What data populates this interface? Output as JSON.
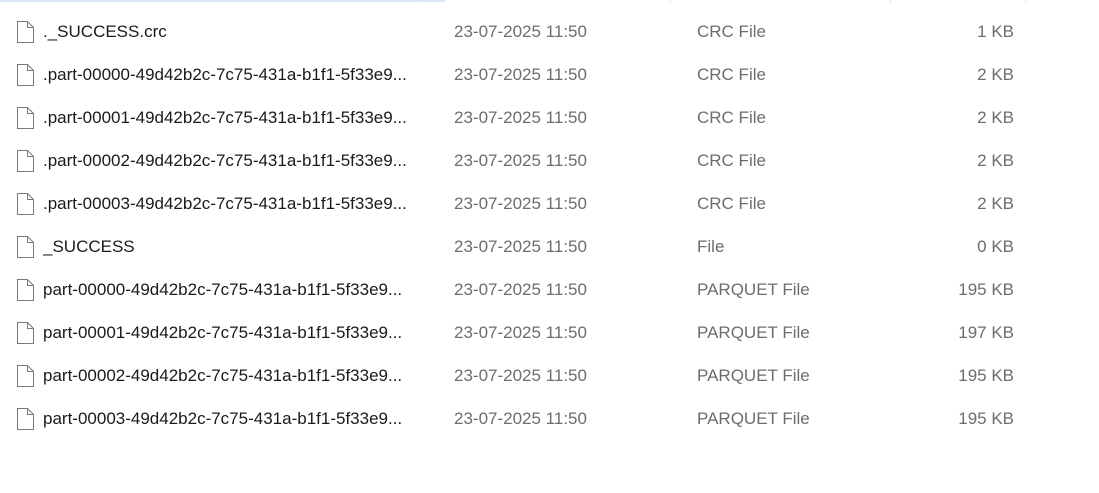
{
  "files": [
    {
      "name": "._SUCCESS.crc",
      "date": "23-07-2025 11:50",
      "type": "CRC File",
      "size": "1 KB",
      "icon": "file-icon"
    },
    {
      "name": ".part-00000-49d42b2c-7c75-431a-b1f1-5f33e9...",
      "date": "23-07-2025 11:50",
      "type": "CRC File",
      "size": "2 KB",
      "icon": "file-icon"
    },
    {
      "name": ".part-00001-49d42b2c-7c75-431a-b1f1-5f33e9...",
      "date": "23-07-2025 11:50",
      "type": "CRC File",
      "size": "2 KB",
      "icon": "file-icon"
    },
    {
      "name": ".part-00002-49d42b2c-7c75-431a-b1f1-5f33e9...",
      "date": "23-07-2025 11:50",
      "type": "CRC File",
      "size": "2 KB",
      "icon": "file-icon"
    },
    {
      "name": ".part-00003-49d42b2c-7c75-431a-b1f1-5f33e9...",
      "date": "23-07-2025 11:50",
      "type": "CRC File",
      "size": "2 KB",
      "icon": "file-icon"
    },
    {
      "name": "_SUCCESS",
      "date": "23-07-2025 11:50",
      "type": "File",
      "size": "0 KB",
      "icon": "file-icon"
    },
    {
      "name": "part-00000-49d42b2c-7c75-431a-b1f1-5f33e9...",
      "date": "23-07-2025 11:50",
      "type": "PARQUET File",
      "size": "195 KB",
      "icon": "file-icon"
    },
    {
      "name": "part-00001-49d42b2c-7c75-431a-b1f1-5f33e9...",
      "date": "23-07-2025 11:50",
      "type": "PARQUET File",
      "size": "197 KB",
      "icon": "file-icon"
    },
    {
      "name": "part-00002-49d42b2c-7c75-431a-b1f1-5f33e9...",
      "date": "23-07-2025 11:50",
      "type": "PARQUET File",
      "size": "195 KB",
      "icon": "file-icon"
    },
    {
      "name": "part-00003-49d42b2c-7c75-431a-b1f1-5f33e9...",
      "date": "23-07-2025 11:50",
      "type": "PARQUET File",
      "size": "195 KB",
      "icon": "file-icon"
    }
  ]
}
